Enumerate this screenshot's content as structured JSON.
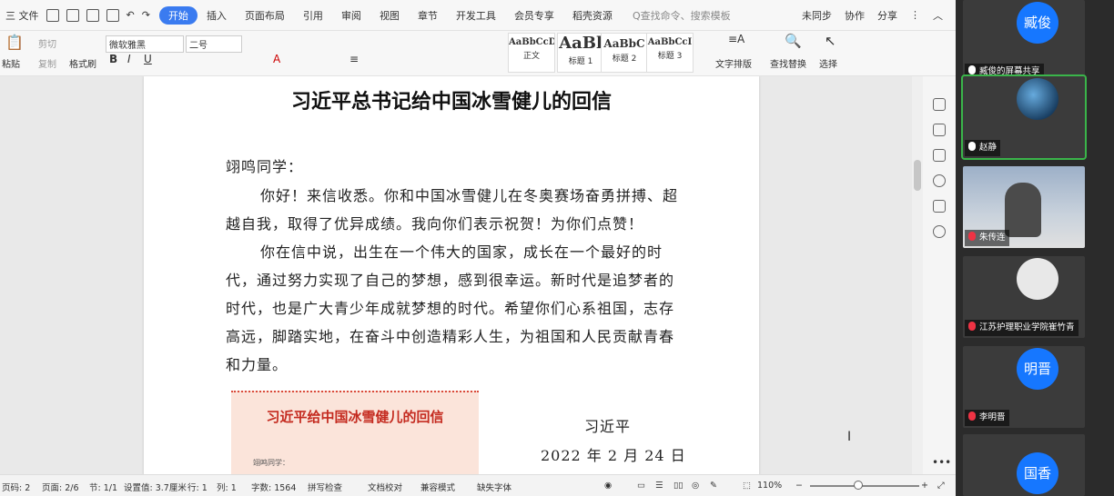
{
  "menubar": {
    "file_label": "三 文件",
    "tabs": [
      "开始",
      "插入",
      "页面布局",
      "引用",
      "审阅",
      "视图",
      "章节",
      "开发工具",
      "会员专享",
      "稻壳资源"
    ],
    "search_placeholder": "Q查找命令、搜索模板",
    "sync": "未同步",
    "collab": "协作",
    "share": "分享"
  },
  "ribbon": {
    "paste": "粘贴",
    "cut": "剪切",
    "copy": "复制",
    "format_painter": "格式刷",
    "font_name": "微软雅黑",
    "font_size": "二号",
    "styles": [
      {
        "sample": "AaBbCcDi",
        "caption": "正文"
      },
      {
        "sample": "AaBl",
        "caption": "标题 1"
      },
      {
        "sample": "AaBbC",
        "caption": "标题 2"
      },
      {
        "sample": "AaBbCcI",
        "caption": "标题 3"
      }
    ],
    "text_layout": "文字排版",
    "find_replace": "查找替换",
    "select": "选择"
  },
  "document": {
    "title": "习近平总书记给中国冰雪健儿的回信",
    "greeting": "翊鸣同学：",
    "paragraphs": [
      "你好！来信收悉。你和中国冰雪健儿在冬奥赛场奋勇拼搏、超越自我，取得了优异成绩。我向你们表示祝贺！为你们点赞！",
      "你在信中说，出生在一个伟大的国家，成长在一个最好的时代，通过努力实现了自己的梦想，感到很幸运。新时代是追梦者的时代，也是广大青少年成就梦想的时代。希望你们心系祖国，志存高远，脚踏实地，在奋斗中创造精彩人生，为祖国和人民贡献青春和力量。"
    ],
    "clipping_title": "习近平给中国冰雪健儿的回信",
    "clipping_greeting": "翊鸣同学：",
    "signature": "习近平",
    "date": "2022 年 2 月 24 日"
  },
  "status": {
    "page_num": "页码: 2",
    "pages": "页面: 2/6",
    "section": "节: 1/1",
    "setting": "设置值: 3.7厘米",
    "row": "行: 1",
    "col": "列: 1",
    "words": "字数: 1564",
    "spell": "拼写检查",
    "proof": "文档校对",
    "compat": "兼容模式",
    "missing_font": "缺失字体",
    "zoom": "110%"
  },
  "meeting": {
    "participants": [
      {
        "avatar": "臧俊",
        "name": "臧俊的屏幕共享",
        "muted": false
      },
      {
        "avatar": "",
        "name": "赵静",
        "muted": false
      },
      {
        "avatar": "",
        "name": "朱传连",
        "muted": true
      },
      {
        "avatar": "",
        "name": "江苏护理职业学院崔竹青",
        "muted": true
      },
      {
        "avatar": "明晋",
        "name": "李明晋",
        "muted": true
      },
      {
        "avatar": "国香",
        "name": "",
        "muted": false
      }
    ]
  }
}
